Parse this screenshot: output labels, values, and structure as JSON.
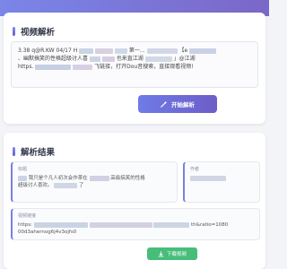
{
  "header": {
    "accent_color": "#7a7fe0"
  },
  "parse_section": {
    "title": "视频解析",
    "share_text_line1_prefix": "3.38 q@R.KW 04/17 H",
    "share_text_line1_mid": "第一...",
    "share_text_line1_end": "【e",
    "share_text_line2_prefix": "、幽默搞笑的性格超级讨人喜",
    "share_text_line2_mid": "也来直江湖",
    "share_text_line2_end": "」@江湖",
    "share_text_line3_prefix": "https.",
    "share_text_line3_end": "飞链接，打开Dou音搜索，直接观看视频!",
    "parse_button_label": "开始解析",
    "parse_button_icon": "wand-icon"
  },
  "result_section": {
    "title": "解析结果",
    "title_field": {
      "label": "标题",
      "line1": "我只是个凡人初次会作茶在",
      "line1_end": "高级搞笑的性格",
      "line2": "超级讨人喜欢。",
      "line2_end": "了"
    },
    "author_field": {
      "label": "作者"
    },
    "link_field": {
      "label": "视频链接",
      "line1_prefix": "https:",
      "line1_end": "th&ratio=1080",
      "line2": "00d3ahernog6j4v3ojfs0"
    },
    "download_button_label": "下载视频",
    "download_button_icon": "download-icon",
    "download_color": "#47bd7a"
  }
}
